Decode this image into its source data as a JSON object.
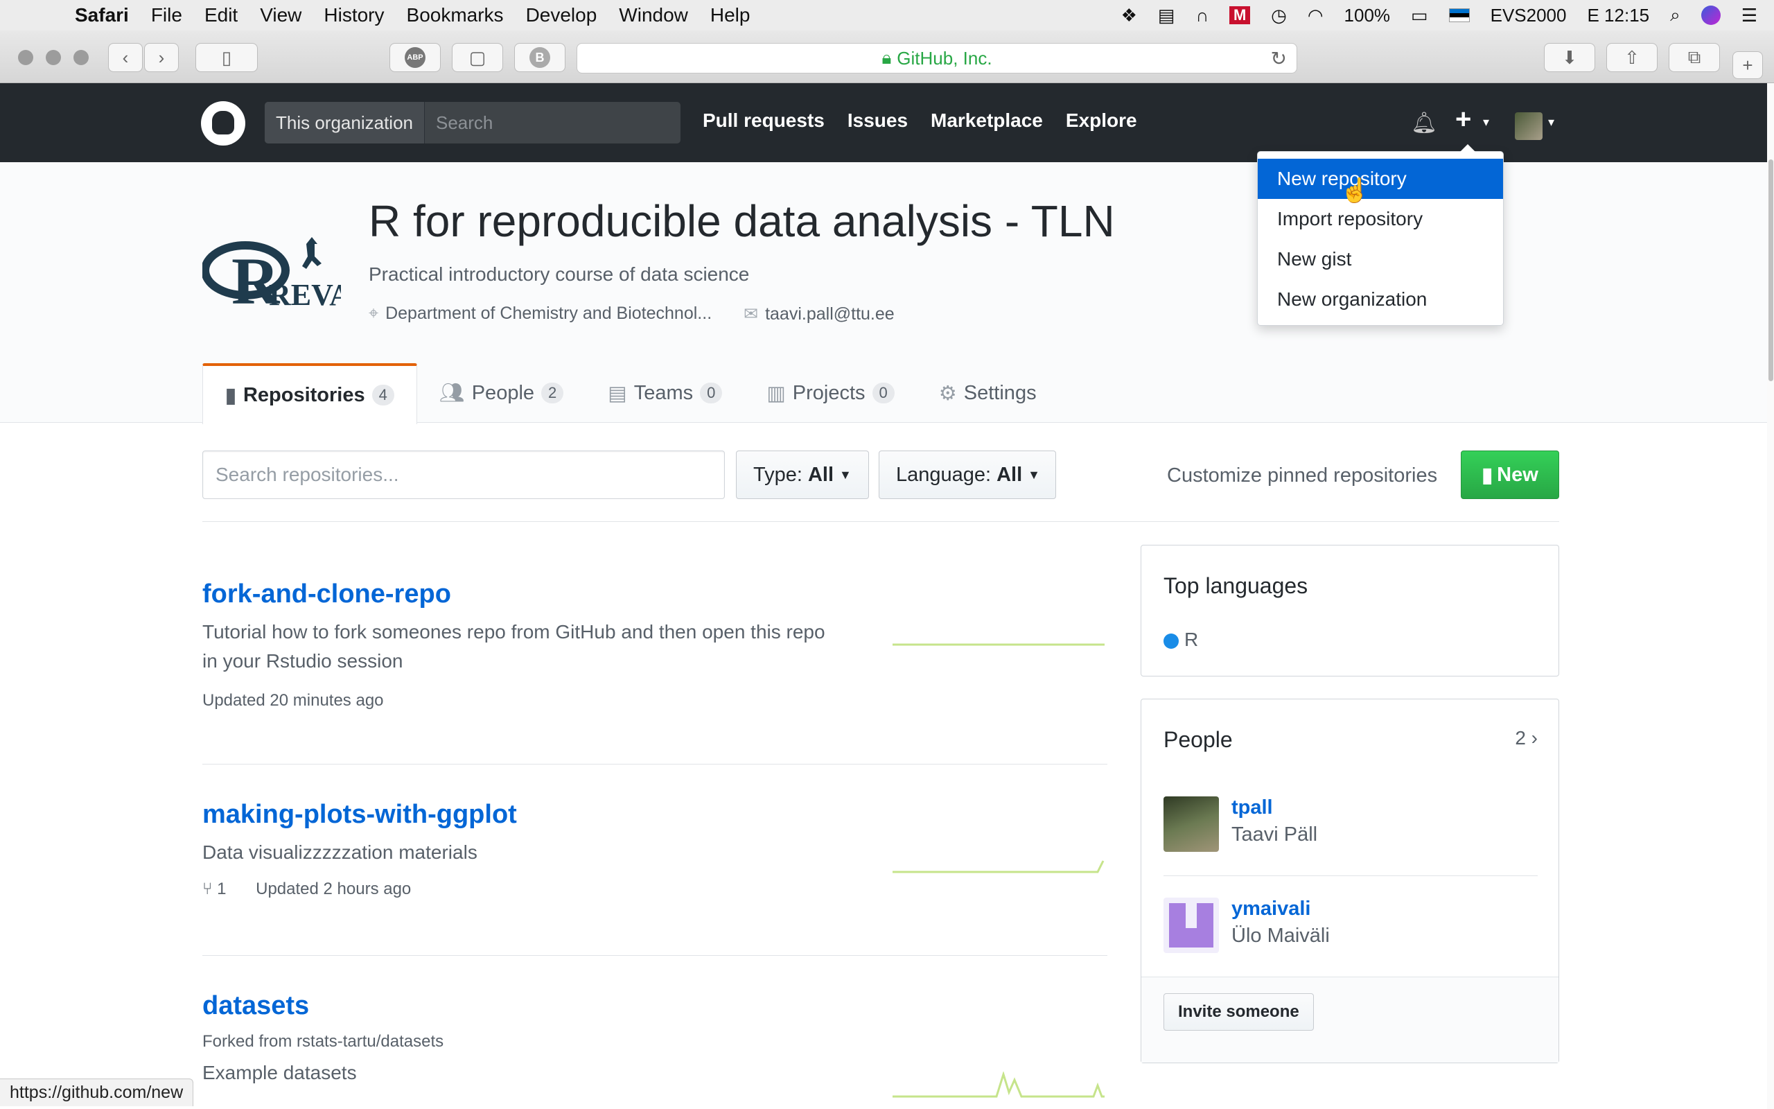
{
  "menubar": {
    "app": "Safari",
    "items": [
      "File",
      "Edit",
      "View",
      "History",
      "Bookmarks",
      "Develop",
      "Window",
      "Help"
    ],
    "battery": "100%",
    "input_source": "EVS2000",
    "clock": "E 12:15"
  },
  "safari": {
    "url_label": "GitHub, Inc.",
    "status_url": "https://github.com/new",
    "abp_label": "ABP",
    "b_label": "B"
  },
  "github_header": {
    "scope": "This organization",
    "search_placeholder": "Search",
    "nav": [
      "Pull requests",
      "Issues",
      "Marketplace",
      "Explore"
    ]
  },
  "dropdown": {
    "items": [
      "New repository",
      "Import repository",
      "New gist",
      "New organization"
    ],
    "active_index": 0
  },
  "org": {
    "name": "R for reproducible data analysis - TLN",
    "description": "Practical introductory course of data science",
    "location": "Department of Chemistry and Biotechnol...",
    "email": "taavi.pall@ttu.ee",
    "logo_text": "REVAL"
  },
  "tabs": [
    {
      "label": "Repositories",
      "count": "4"
    },
    {
      "label": "People",
      "count": "2"
    },
    {
      "label": "Teams",
      "count": "0"
    },
    {
      "label": "Projects",
      "count": "0"
    },
    {
      "label": "Settings",
      "count": ""
    }
  ],
  "filters": {
    "search_placeholder": "Search repositories...",
    "type_label": "Type:",
    "type_value": "All",
    "language_label": "Language:",
    "language_value": "All",
    "customize": "Customize pinned repositories",
    "new_button": "New"
  },
  "repos": [
    {
      "name": "fork-and-clone-repo",
      "description": "Tutorial how to fork someones repo from GitHub and then open this repo in your Rstudio session",
      "forks": "",
      "updated": "Updated 20 minutes ago",
      "forked_from": ""
    },
    {
      "name": "making-plots-with-ggplot",
      "description": "Data visualizzzzzation materials",
      "forks": "1",
      "updated": "Updated 2 hours ago",
      "forked_from": ""
    },
    {
      "name": "datasets",
      "description": "Example datasets",
      "forks": "",
      "updated": "",
      "forked_from": "Forked from rstats-tartu/datasets"
    }
  ],
  "sidebar": {
    "top_languages_title": "Top languages",
    "languages": [
      {
        "name": "R",
        "color": "#198ce7"
      }
    ],
    "people_title": "People",
    "people_count": "2",
    "people": [
      {
        "login": "tpall",
        "name": "Taavi Päll"
      },
      {
        "login": "ymaivali",
        "name": "Ülo Maiväli"
      }
    ],
    "invite_button": "Invite someone"
  },
  "colors": {
    "github_dark": "#24292e",
    "link_blue": "#0366d6",
    "green_button": "#28a745",
    "tab_accent": "#e36209"
  }
}
